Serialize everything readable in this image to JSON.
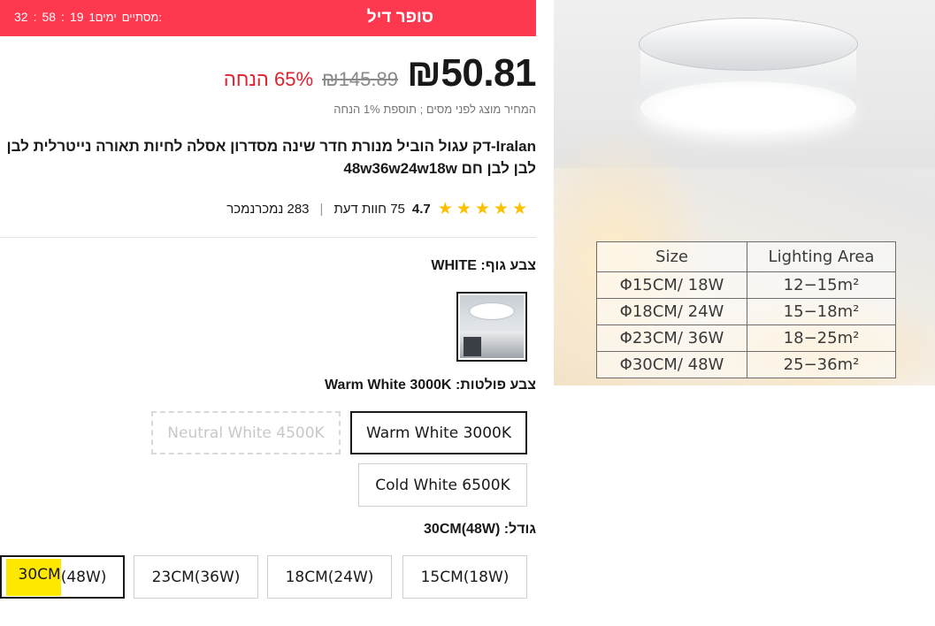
{
  "deal": {
    "title": "סופר דיל",
    "ends_label": "מסתיים:",
    "days": "1ימים",
    "hours": "19",
    "minutes": "58",
    "seconds": "32"
  },
  "price": {
    "current": "₪50.81",
    "original": "₪145.89",
    "discount": "65% הנחה",
    "tax_note": "המחיר מוצג לפני מסים ; תוספת 1% הנחה"
  },
  "product": {
    "title": "Iralan-דק עגול הוביל מנורת חדר שינה מסדרון אסלה לחיות תאורה נייטרלית לבן לבן לבן חם 48w36w24w18w"
  },
  "rating": {
    "value": "4.7",
    "reviews": "75 חוות דעת",
    "sold": "283 נמכרנמכר",
    "stars": 5,
    "star_color": "#fdc000"
  },
  "body_color": {
    "label": "צבע גוף:",
    "value": "WHITE"
  },
  "light_color": {
    "label": "צבע פולטות:",
    "value": "Warm White 3000K",
    "options": [
      "Warm White 3000K",
      "Neutral White 4500K",
      "Cold White 6500K"
    ]
  },
  "size": {
    "label": "גודל:",
    "value": "30CM(48W)",
    "options": [
      "15CM(18W)",
      "18CM(24W)",
      "23CM(36W)",
      "30CM(48W)"
    ],
    "highlight_part": "30CM",
    "rest_part": "(48W)"
  },
  "spec_table": {
    "headers": [
      "Size",
      "Lighting Area"
    ],
    "rows": [
      [
        "Φ15CM/ 18W",
        "12−15m²"
      ],
      [
        "Φ18CM/ 24W",
        "15−18m²"
      ],
      [
        "Φ23CM/ 36W",
        "18−25m²"
      ],
      [
        "Φ30CM/ 48W",
        "25−36m²"
      ]
    ]
  },
  "colors": {
    "deal_bar": "#fd384f",
    "discount": "#e0212f",
    "highlight": "#ffe800"
  }
}
